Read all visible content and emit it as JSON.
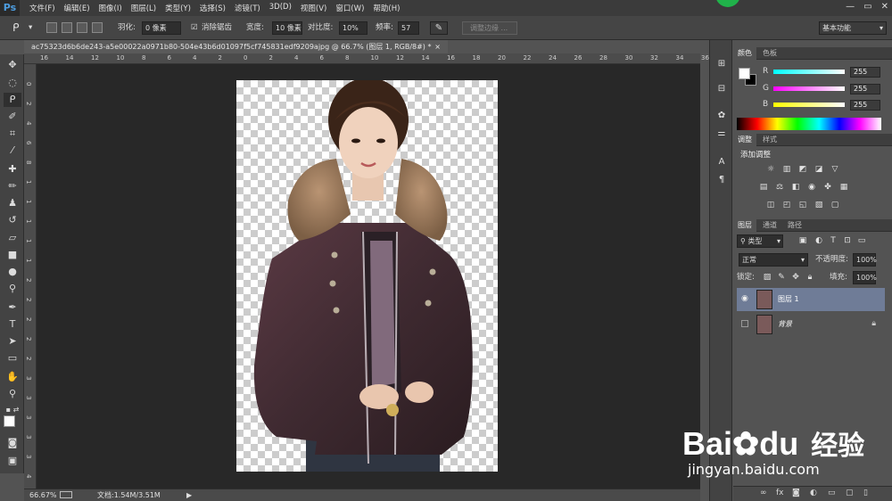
{
  "app": {
    "logo": "Ps"
  },
  "menu": [
    "文件(F)",
    "编辑(E)",
    "图像(I)",
    "图层(L)",
    "类型(Y)",
    "选择(S)",
    "滤镜(T)",
    "3D(D)",
    "视图(V)",
    "窗口(W)",
    "帮助(H)"
  ],
  "window_controls": [
    "—",
    "▭",
    "✕"
  ],
  "options": {
    "feather_label": "羽化:",
    "feather_value": "0 像素",
    "antialias_label": "消除锯齿",
    "width_label": "宽度:",
    "width_value": "10 像素",
    "contrast_label": "对比度:",
    "contrast_value": "10%",
    "frequency_label": "频率:",
    "frequency_value": "57",
    "refine_edge": "调整边缘 ...",
    "workspace": "基本功能"
  },
  "document": {
    "tab_title": "ac75323d6b6de243-a5e00022a0971b80-504e43b6d01097f5cf745831edf9209ajpg @ 66.7% (图层 1, RGB/8#) *",
    "close": "×",
    "ruler_top": [
      "16",
      "14",
      "12",
      "10",
      "8",
      "6",
      "4",
      "2",
      "0",
      "2",
      "4",
      "6",
      "8",
      "10",
      "12",
      "14",
      "16",
      "18",
      "20",
      "22",
      "24",
      "26",
      "28",
      "30",
      "32",
      "34",
      "36"
    ],
    "ruler_left": [
      "0",
      "2",
      "4",
      "6",
      "8",
      "1",
      "1",
      "1",
      "1",
      "1",
      "2",
      "2",
      "2",
      "2",
      "2",
      "3",
      "3",
      "3",
      "3",
      "3",
      "4"
    ]
  },
  "status": {
    "zoom": "66.67%",
    "doc_size": "文档:1.54M/3.51M"
  },
  "color_panel": {
    "tabs": [
      "颜色",
      "色板"
    ],
    "channels": [
      {
        "label": "R",
        "value": "255"
      },
      {
        "label": "G",
        "value": "255"
      },
      {
        "label": "B",
        "value": "255"
      }
    ]
  },
  "adjust_panel": {
    "tabs": [
      "调整",
      "样式"
    ],
    "title": "添加调整"
  },
  "layers_panel": {
    "tabs": [
      "图层",
      "通道",
      "路径"
    ],
    "filter": "类型",
    "blend_mode": "正常",
    "opacity_label": "不透明度:",
    "opacity_value": "100%",
    "lock_label": "锁定:",
    "fill_label": "填充:",
    "fill_value": "100%",
    "layers": [
      {
        "name": "图层 1",
        "selected": true
      },
      {
        "name": "背景",
        "selected": false
      }
    ]
  },
  "watermark": {
    "brand": "Bai",
    "brand2": "du",
    "cn": "经验",
    "url": "jingyan.baidu.com"
  }
}
